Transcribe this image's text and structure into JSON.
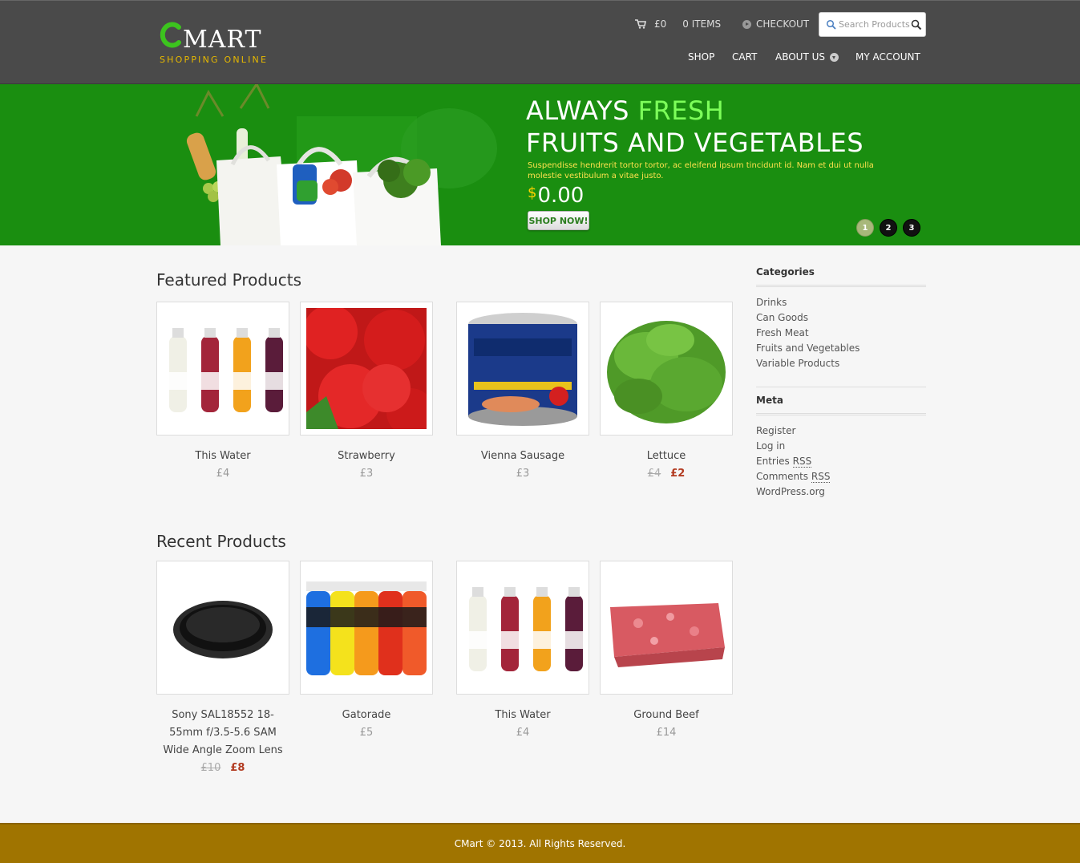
{
  "logo": {
    "word": "MART",
    "tagline": "SHOPPING ONLINE"
  },
  "topbar": {
    "cart_amount": "£0",
    "cart_items": "0 ITEMS",
    "checkout": "CHECKOUT"
  },
  "search": {
    "placeholder": "Search Products"
  },
  "nav": {
    "shop": "SHOP",
    "cart": "CART",
    "about": "ABOUT US",
    "account": "MY ACCOUNT"
  },
  "hero": {
    "title_part1": "ALWAYS ",
    "title_part2": "FRESH",
    "title_line2": "FRUITS AND VEGETABLES",
    "description": "Suspendisse hendrerit tortor tortor, ac eleifend ipsum tincidunt id. Nam et dui ut nulla molestie vestibulum a vitae justo.",
    "price_currency": "$",
    "price_value": "0.00",
    "button": "SHOP NOW!",
    "pages": [
      "1",
      "2",
      "3"
    ],
    "active_page": "1"
  },
  "featured": {
    "title": "Featured Products",
    "products": [
      {
        "name": "This Water",
        "price": "£4"
      },
      {
        "name": "Strawberry",
        "price": "£3"
      },
      {
        "name": "Vienna Sausage",
        "price": "£3"
      },
      {
        "name": "Lettuce",
        "old_price": "£4",
        "price": "£2"
      }
    ]
  },
  "recent": {
    "title": "Recent Products",
    "products": [
      {
        "name": "Sony SAL18552 18-55mm f/3.5-5.6 SAM Wide Angle Zoom Lens",
        "old_price": "£10",
        "price": "£8"
      },
      {
        "name": "Gatorade",
        "price": "£5"
      },
      {
        "name": "This Water",
        "price": "£4"
      },
      {
        "name": "Ground Beef",
        "price": "£14"
      }
    ]
  },
  "sidebar": {
    "categories_title": "Categories",
    "categories": [
      "Drinks",
      "Can Goods",
      "Fresh Meat",
      "Fruits and Vegetables",
      "Variable Products"
    ],
    "meta_title": "Meta",
    "meta": {
      "register": "Register",
      "login": "Log in",
      "entries": "Entries ",
      "entries_abbr": "RSS",
      "comments": "Comments ",
      "comments_abbr": "RSS",
      "wordpress": "WordPress.org"
    }
  },
  "footer": {
    "text": "CMart © 2013. All Rights Reserved."
  },
  "colors": {
    "header": "#4a4a4a",
    "hero": "#1a8e10",
    "accent_green": "#7dff5a",
    "sale_red": "#b23a20",
    "footer": "#a07400"
  }
}
